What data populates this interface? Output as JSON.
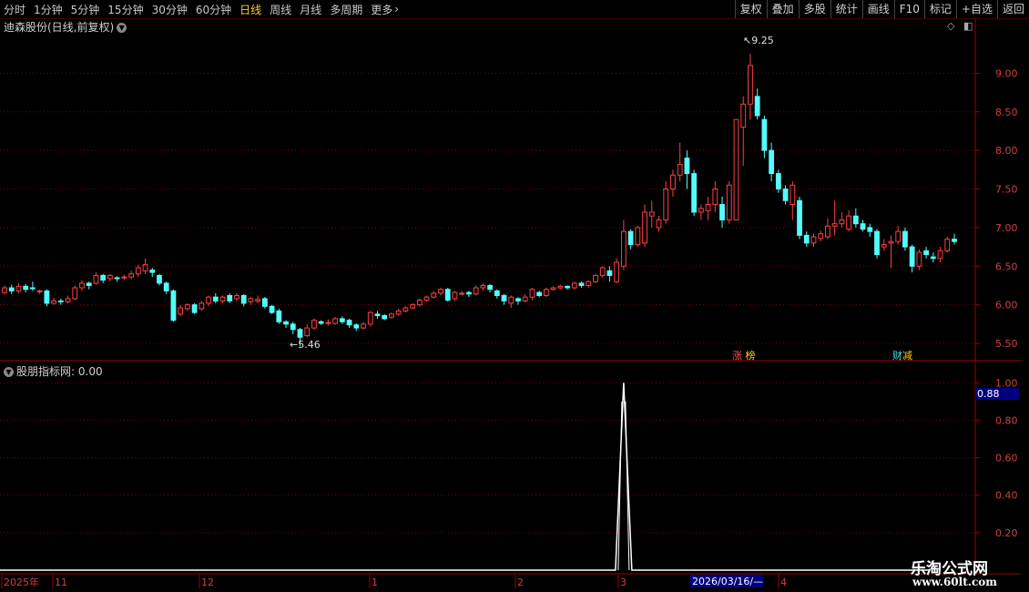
{
  "toolbar": {
    "periods": [
      "分时",
      "1分钟",
      "5分钟",
      "15分钟",
      "30分钟",
      "60分钟",
      "日线",
      "周线",
      "月线",
      "多周期",
      "更多"
    ],
    "active_period": "日线",
    "more_chevron": "›",
    "actions": [
      "复权",
      "叠加",
      "多股",
      "统计",
      "画线",
      "F10",
      "标记",
      "+自选",
      "返回"
    ]
  },
  "chart": {
    "title": "迪森股份(日线,前复权)",
    "price_ticks": [
      "9.00",
      "8.50",
      "8.00",
      "7.50",
      "7.00",
      "6.50",
      "6.00",
      "5.50"
    ],
    "high_label": "9.25",
    "low_label": "5.46",
    "tags": [
      {
        "text": "涨",
        "color": "#ff5050"
      },
      {
        "text": "榜",
        "color": "#ffcc00"
      },
      {
        "text": "财",
        "color": "#40e0e0"
      },
      {
        "text": "减",
        "color": "#ffcc00"
      }
    ],
    "colors": {
      "up": "#ff4040",
      "down": "#54fcfc",
      "grid": "#800000",
      "axis": "#a00000"
    }
  },
  "indicator": {
    "title": "股朋指标网",
    "value_text": ": 0.00",
    "ticks": [
      "1.00",
      "0.80",
      "0.60",
      "0.40",
      "0.20"
    ],
    "cursor_value": "0.88"
  },
  "date_axis": {
    "labels": [
      "2025年",
      "11",
      "12",
      "1",
      "2",
      "3",
      "4"
    ],
    "highlight": "2026/03/16/—"
  },
  "watermark": {
    "line1": "乐淘公式网",
    "line2": "www.60lt.com"
  },
  "chart_data": {
    "type": "candlestick",
    "series": [
      {
        "values": [
          [
            6.16,
            6.22,
            6.13,
            6.25
          ],
          [
            6.22,
            6.18,
            6.14,
            6.26
          ],
          [
            6.18,
            6.24,
            6.15,
            6.28
          ],
          [
            6.24,
            6.2,
            6.16,
            6.27
          ],
          [
            6.22,
            6.21,
            6.18,
            6.3
          ],
          [
            6.17,
            6.18,
            6.14,
            6.2
          ],
          [
            6.18,
            6.02,
            5.98,
            6.2
          ],
          [
            6.02,
            6.05,
            6.0,
            6.09
          ],
          [
            6.05,
            6.04,
            6.0,
            6.08
          ],
          [
            6.04,
            6.08,
            6.02,
            6.12
          ],
          [
            6.08,
            6.22,
            6.06,
            6.25
          ],
          [
            6.22,
            6.28,
            6.18,
            6.32
          ],
          [
            6.28,
            6.25,
            6.2,
            6.3
          ],
          [
            6.28,
            6.38,
            6.26,
            6.42
          ],
          [
            6.38,
            6.32,
            6.28,
            6.4
          ],
          [
            6.34,
            6.38,
            6.3,
            6.4
          ],
          [
            6.35,
            6.34,
            6.3,
            6.37
          ],
          [
            6.35,
            6.36,
            6.32,
            6.39
          ],
          [
            6.36,
            6.4,
            6.33,
            6.44
          ],
          [
            6.4,
            6.48,
            6.36,
            6.52
          ],
          [
            6.44,
            6.52,
            6.4,
            6.6
          ],
          [
            6.45,
            6.42,
            6.36,
            6.48
          ],
          [
            6.38,
            6.28,
            6.25,
            6.4
          ],
          [
            6.28,
            6.18,
            6.14,
            6.3
          ],
          [
            6.18,
            5.8,
            5.78,
            6.2
          ],
          [
            5.88,
            5.96,
            5.85,
            6.0
          ],
          [
            5.95,
            6.0,
            5.92,
            6.02
          ],
          [
            6.0,
            5.9,
            5.88,
            6.02
          ],
          [
            5.95,
            6.02,
            5.92,
            6.05
          ],
          [
            6.02,
            6.1,
            5.98,
            6.12
          ],
          [
            6.1,
            6.05,
            6.02,
            6.15
          ],
          [
            6.05,
            6.1,
            6.02,
            6.12
          ],
          [
            6.12,
            6.05,
            6.02,
            6.15
          ],
          [
            6.08,
            6.12,
            6.05,
            6.15
          ],
          [
            6.12,
            6.02,
            5.98,
            6.14
          ],
          [
            6.04,
            6.08,
            6.0,
            6.1
          ],
          [
            6.05,
            6.07,
            6.02,
            6.12
          ],
          [
            6.08,
            5.98,
            5.95,
            6.1
          ],
          [
            5.98,
            5.9,
            5.88,
            6.0
          ],
          [
            5.92,
            5.78,
            5.75,
            5.95
          ],
          [
            5.78,
            5.75,
            5.7,
            5.8
          ],
          [
            5.75,
            5.68,
            5.62,
            5.78
          ],
          [
            5.68,
            5.58,
            5.46,
            5.7
          ],
          [
            5.6,
            5.7,
            5.58,
            5.75
          ],
          [
            5.7,
            5.8,
            5.68,
            5.82
          ],
          [
            5.78,
            5.76,
            5.74,
            5.8
          ],
          [
            5.76,
            5.77,
            5.73,
            5.81
          ],
          [
            5.76,
            5.82,
            5.74,
            5.84
          ],
          [
            5.82,
            5.78,
            5.75,
            5.85
          ],
          [
            5.8,
            5.74,
            5.7,
            5.82
          ],
          [
            5.74,
            5.7,
            5.66,
            5.76
          ],
          [
            5.7,
            5.75,
            5.68,
            5.78
          ],
          [
            5.75,
            5.9,
            5.72,
            5.92
          ],
          [
            5.88,
            5.86,
            5.82,
            5.92
          ],
          [
            5.86,
            5.82,
            5.8,
            5.88
          ],
          [
            5.84,
            5.88,
            5.82,
            5.9
          ],
          [
            5.88,
            5.92,
            5.86,
            5.95
          ],
          [
            5.92,
            5.96,
            5.9,
            5.98
          ],
          [
            5.96,
            6.0,
            5.94,
            6.02
          ],
          [
            6.0,
            6.06,
            5.98,
            6.08
          ],
          [
            6.06,
            6.1,
            6.04,
            6.12
          ],
          [
            6.1,
            6.15,
            6.08,
            6.18
          ],
          [
            6.15,
            6.2,
            6.12,
            6.22
          ],
          [
            6.2,
            6.06,
            6.04,
            6.22
          ],
          [
            6.08,
            6.16,
            6.05,
            6.18
          ],
          [
            6.14,
            6.15,
            6.12,
            6.18
          ],
          [
            6.16,
            6.14,
            6.1,
            6.18
          ],
          [
            6.14,
            6.22,
            6.12,
            6.25
          ],
          [
            6.22,
            6.25,
            6.18,
            6.28
          ],
          [
            6.25,
            6.2,
            6.16,
            6.27
          ],
          [
            6.18,
            6.12,
            6.08,
            6.2
          ],
          [
            6.12,
            6.05,
            6.0,
            6.14
          ],
          [
            6.02,
            6.1,
            5.96,
            6.12
          ],
          [
            6.08,
            6.05,
            6.0,
            6.1
          ],
          [
            6.05,
            6.1,
            6.03,
            6.14
          ],
          [
            6.1,
            6.2,
            6.06,
            6.22
          ],
          [
            6.16,
            6.12,
            6.1,
            6.18
          ],
          [
            6.12,
            6.2,
            6.1,
            6.22
          ],
          [
            6.2,
            6.22,
            6.18,
            6.24
          ],
          [
            6.22,
            6.24,
            6.2,
            6.26
          ],
          [
            6.24,
            6.22,
            6.2,
            6.25
          ],
          [
            6.22,
            6.28,
            6.2,
            6.3
          ],
          [
            6.28,
            6.25,
            6.22,
            6.3
          ],
          [
            6.25,
            6.3,
            6.22,
            6.32
          ],
          [
            6.3,
            6.38,
            6.28,
            6.4
          ],
          [
            6.38,
            6.48,
            6.35,
            6.5
          ],
          [
            6.44,
            6.38,
            6.3,
            6.5
          ],
          [
            6.3,
            6.55,
            6.28,
            6.6
          ],
          [
            6.5,
            6.95,
            6.45,
            7.1
          ],
          [
            6.95,
            6.78,
            6.72,
            6.98
          ],
          [
            6.78,
            7.0,
            6.75,
            7.02
          ],
          [
            6.8,
            7.2,
            6.75,
            7.3
          ],
          [
            7.15,
            7.2,
            7.0,
            7.35
          ],
          [
            7.0,
            7.1,
            6.95,
            7.15
          ],
          [
            7.1,
            7.5,
            7.05,
            7.6
          ],
          [
            7.5,
            7.68,
            7.4,
            7.75
          ],
          [
            7.68,
            7.82,
            7.6,
            8.1
          ],
          [
            7.9,
            7.7,
            7.5,
            8.0
          ],
          [
            7.7,
            7.2,
            7.15,
            7.75
          ],
          [
            7.2,
            7.25,
            7.1,
            7.3
          ],
          [
            7.22,
            7.3,
            7.1,
            7.4
          ],
          [
            7.3,
            7.5,
            7.2,
            7.6
          ],
          [
            7.3,
            7.1,
            7.0,
            7.4
          ],
          [
            7.1,
            7.55,
            7.05,
            7.6
          ],
          [
            7.1,
            8.4,
            7.1,
            8.4
          ],
          [
            8.3,
            8.6,
            7.8,
            8.7
          ],
          [
            8.6,
            9.1,
            8.4,
            9.25
          ],
          [
            8.7,
            8.45,
            8.4,
            8.8
          ],
          [
            8.4,
            8.0,
            7.9,
            8.45
          ],
          [
            8.0,
            7.7,
            7.6,
            8.1
          ],
          [
            7.7,
            7.5,
            7.45,
            7.75
          ],
          [
            7.5,
            7.35,
            7.3,
            7.55
          ],
          [
            7.3,
            7.55,
            7.1,
            7.6
          ],
          [
            7.35,
            6.9,
            6.85,
            7.4
          ],
          [
            6.9,
            6.8,
            6.75,
            6.95
          ],
          [
            6.8,
            6.88,
            6.75,
            6.92
          ],
          [
            6.86,
            6.92,
            6.82,
            6.96
          ],
          [
            6.88,
            7.02,
            6.85,
            7.12
          ],
          [
            7.02,
            7.05,
            6.9,
            7.35
          ],
          [
            7.05,
            7.1,
            7.0,
            7.2
          ],
          [
            6.98,
            7.15,
            6.95,
            7.22
          ],
          [
            7.15,
            7.05,
            7.0,
            7.25
          ],
          [
            7.05,
            6.98,
            6.95,
            7.1
          ],
          [
            7.0,
            6.95,
            6.88,
            7.05
          ],
          [
            6.95,
            6.65,
            6.6,
            6.98
          ],
          [
            6.75,
            6.78,
            6.7,
            6.85
          ],
          [
            6.8,
            6.82,
            6.48,
            6.9
          ],
          [
            6.82,
            6.95,
            6.78,
            7.02
          ],
          [
            6.95,
            6.75,
            6.7,
            7.0
          ],
          [
            6.75,
            6.5,
            6.42,
            6.78
          ],
          [
            6.5,
            6.68,
            6.45,
            6.72
          ],
          [
            6.7,
            6.65,
            6.6,
            6.75
          ],
          [
            6.62,
            6.6,
            6.55,
            6.68
          ],
          [
            6.6,
            6.7,
            6.55,
            6.75
          ],
          [
            6.7,
            6.85,
            6.68,
            6.88
          ],
          [
            6.85,
            6.82,
            6.78,
            6.92
          ]
        ]
      }
    ],
    "value_format": "[open, close, low, high]",
    "y_range": [
      5.3,
      9.5
    ],
    "indicator": {
      "spike_value": 1.0,
      "baseline": 0.0,
      "y_range": [
        0,
        1.05
      ]
    }
  }
}
